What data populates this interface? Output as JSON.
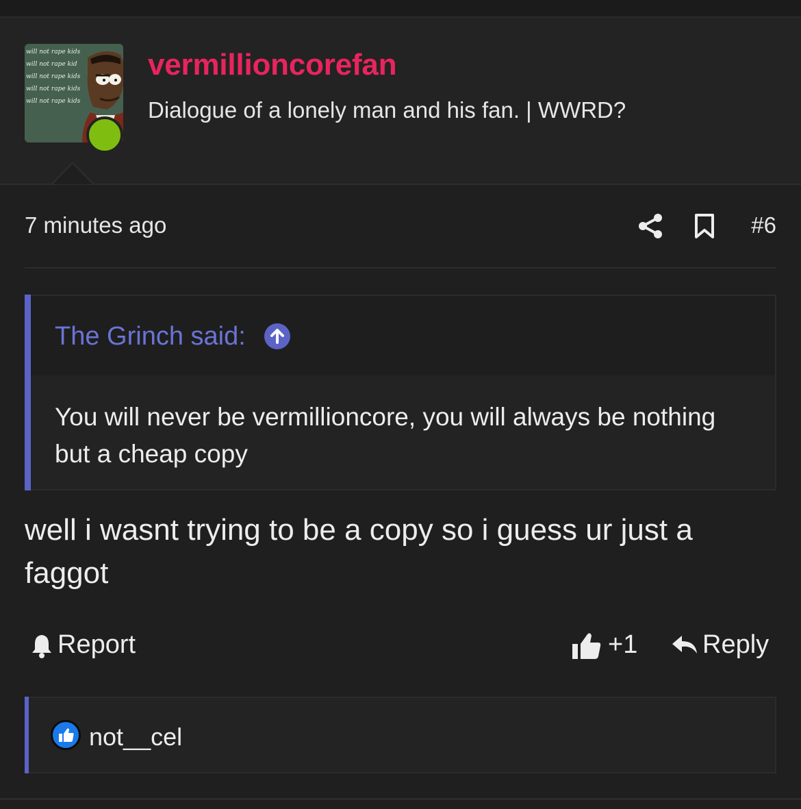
{
  "user": {
    "name": "vermillioncorefan",
    "title": "Dialogue of a lonely man and his fan. | WWRD?",
    "avatar_lines": [
      "will not rape kids",
      "will not rape kid",
      "will not rape kids",
      "will not rape kids",
      "will not rape kids"
    ],
    "online_color": "#7fbd11",
    "name_color": "#e8245f"
  },
  "post": {
    "time": "7 minutes ago",
    "number": "#6",
    "icons": [
      "share-icon",
      "bookmark-icon"
    ],
    "quote": {
      "author": "The Grinch said:",
      "text": "You will never be vermillioncore, you will always be nothing but a cheap copy",
      "accent_color": "#5c63c7"
    },
    "body": "well i wasnt trying to be a copy so i guess ur just a faggot",
    "actions": {
      "report": "Report",
      "like_count": "+1",
      "reply": "Reply"
    },
    "reactions": {
      "user": "not__cel",
      "icon": "thumbs-up-icon"
    }
  }
}
